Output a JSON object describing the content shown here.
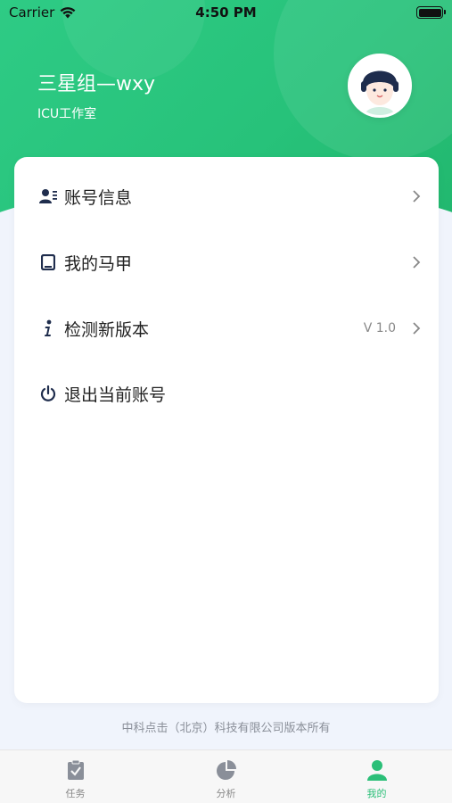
{
  "status_bar": {
    "carrier": "Carrier",
    "time": "4:50 PM"
  },
  "profile": {
    "name": "三星组—wxy",
    "subtitle": "ICU工作室"
  },
  "menu": [
    {
      "label": "账号信息",
      "icon": "user-card-icon",
      "value": "",
      "chevron": true
    },
    {
      "label": "我的马甲",
      "icon": "device-icon",
      "value": "",
      "chevron": true
    },
    {
      "label": "检测新版本",
      "icon": "info-icon",
      "value": "V 1.0",
      "chevron": true
    },
    {
      "label": "退出当前账号",
      "icon": "power-icon",
      "value": "",
      "chevron": false
    }
  ],
  "footer": "中科点击（北京）科技有限公司版本所有",
  "tabs": [
    {
      "label": "任务",
      "icon": "clipboard-check-icon",
      "active": false
    },
    {
      "label": "分析",
      "icon": "pie-chart-icon",
      "active": false
    },
    {
      "label": "我的",
      "icon": "person-icon",
      "active": true
    }
  ],
  "colors": {
    "brand": "#2ecb85",
    "active_tab": "#2bbf78",
    "icon_dark": "#1f2d4d"
  }
}
